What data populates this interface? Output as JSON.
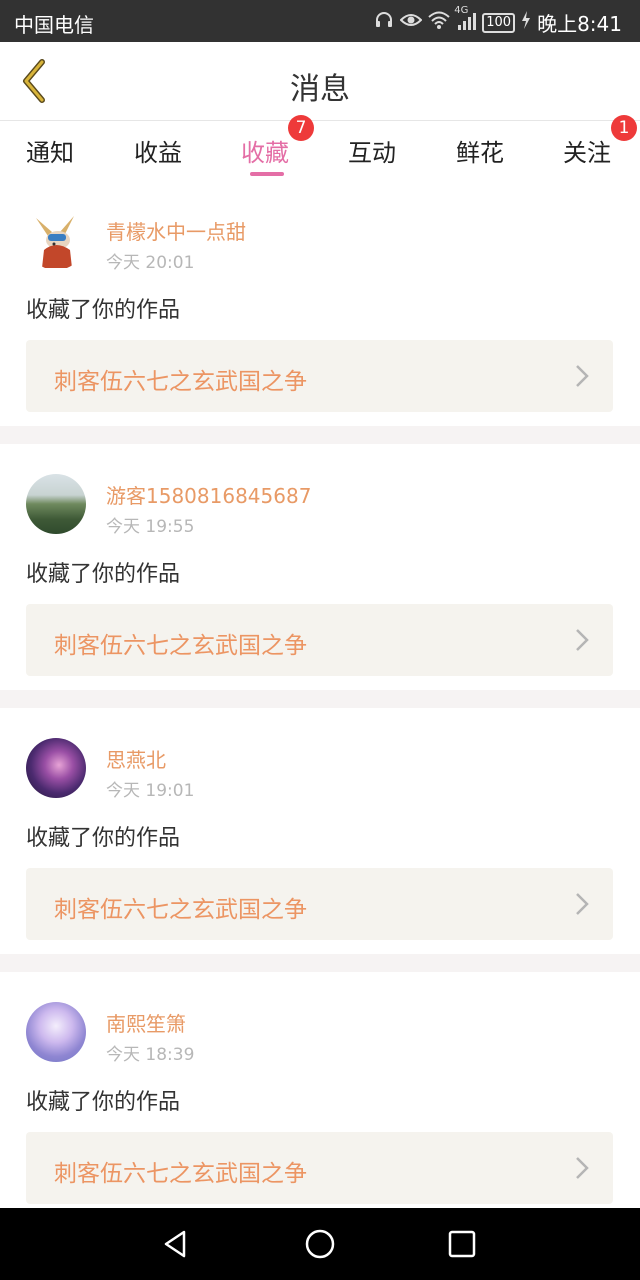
{
  "status_bar": {
    "carrier": "中国电信",
    "network": "4G",
    "battery": "100",
    "time": "晚上8:41"
  },
  "header": {
    "title": "消息"
  },
  "tabs": [
    {
      "label": "通知",
      "active": false,
      "badge": null
    },
    {
      "label": "收益",
      "active": false,
      "badge": null
    },
    {
      "label": "收藏",
      "active": true,
      "badge": "7"
    },
    {
      "label": "互动",
      "active": false,
      "badge": null
    },
    {
      "label": "鲜花",
      "active": false,
      "badge": null
    },
    {
      "label": "关注",
      "active": false,
      "badge": "1"
    }
  ],
  "notifications": [
    {
      "username": "青檬水中一点甜",
      "time": "今天 20:01",
      "action": "收藏了你的作品",
      "work_title": "刺客伍六七之玄武国之争"
    },
    {
      "username": "游客1580816845687",
      "time": "今天 19:55",
      "action": "收藏了你的作品",
      "work_title": "刺客伍六七之玄武国之争"
    },
    {
      "username": "思燕北",
      "time": "今天 19:01",
      "action": "收藏了你的作品",
      "work_title": "刺客伍六七之玄武国之争"
    },
    {
      "username": "南熙笙箫",
      "time": "今天 18:39",
      "action": "收藏了你的作品",
      "work_title": "刺客伍六七之玄武国之争"
    }
  ],
  "colors": {
    "accent": "#e46ea6",
    "username": "#e89a66",
    "work_title": "#ec9563",
    "badge": "#ee3a3a",
    "back_arrow": "#c9a634"
  },
  "icons": {
    "back": "chevron-left-icon",
    "nav_back": "triangle-back-icon",
    "nav_home": "circle-home-icon",
    "nav_recent": "square-recent-icon"
  }
}
